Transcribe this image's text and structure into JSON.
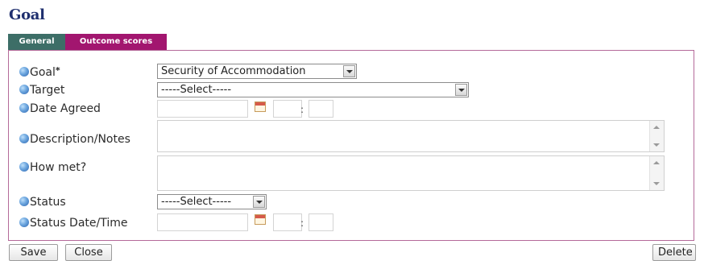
{
  "page": {
    "title": "Goal"
  },
  "tabs": [
    {
      "label": "General",
      "active": false
    },
    {
      "label": "Outcome scores",
      "active": true
    }
  ],
  "form": {
    "goal": {
      "label": "Goal",
      "required_mark": "*",
      "value": "Security of Accommodation"
    },
    "target": {
      "label": "Target",
      "value": "-----Select-----"
    },
    "date_agreed": {
      "label": "Date Agreed",
      "date": "",
      "hour": "",
      "minute": "",
      "separator": ":"
    },
    "description": {
      "label": "Description/Notes",
      "value": ""
    },
    "how_met": {
      "label": "How met?",
      "value": ""
    },
    "status": {
      "label": "Status",
      "value": "-----Select-----"
    },
    "status_datetime": {
      "label": "Status Date/Time",
      "date": "",
      "hour": "",
      "minute": "",
      "separator": ":"
    }
  },
  "actions": {
    "save_label": "Save",
    "close_label": "Close",
    "delete_label": "Delete"
  },
  "colors": {
    "title": "#1f2f6e",
    "tab_general": "#3d6e67",
    "tab_outcome": "#a2166f",
    "panel_border": "#b56a9a"
  },
  "icons": {
    "help": "help-icon",
    "calendar": "calendar-icon",
    "dropdown": "chevron-down-icon"
  }
}
